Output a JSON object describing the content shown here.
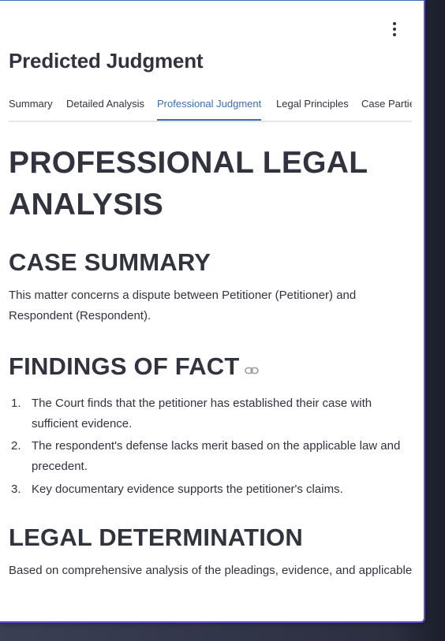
{
  "page": {
    "title": "Predicted Judgment"
  },
  "tabs": [
    {
      "label": "Summary"
    },
    {
      "label": "Detailed Analysis"
    },
    {
      "label": "Professional Judgment"
    },
    {
      "label": "Legal Principles"
    },
    {
      "label": "Case Partie"
    }
  ],
  "active_tab": "Professional Judgment",
  "icons": {
    "menu": "more-vertical-icon",
    "anchor": "link-icon"
  },
  "colors": {
    "accent": "#3c6fb4",
    "text": "#31333f",
    "panel_border": "#5a4fc8"
  },
  "document": {
    "heading": "PROFESSIONAL LEGAL ANALYSIS",
    "case_summary": {
      "heading": "CASE SUMMARY",
      "text": "This matter concerns a dispute between Petitioner (Petitioner) and Respondent (Respondent)."
    },
    "findings": {
      "heading": "FINDINGS OF FACT",
      "items": [
        {
          "number": "1.",
          "text": "The Court finds that the petitioner has established their case with sufficient evidence."
        },
        {
          "number": "2.",
          "text": "The respondent's defense lacks merit based on the applicable law and precedent."
        },
        {
          "number": "3.",
          "text": "Key documentary evidence supports the petitioner's claims."
        }
      ]
    },
    "legal_determination": {
      "heading": "LEGAL DETERMINATION",
      "text": "Based on comprehensive analysis of the pleadings, evidence, and applicable"
    }
  }
}
